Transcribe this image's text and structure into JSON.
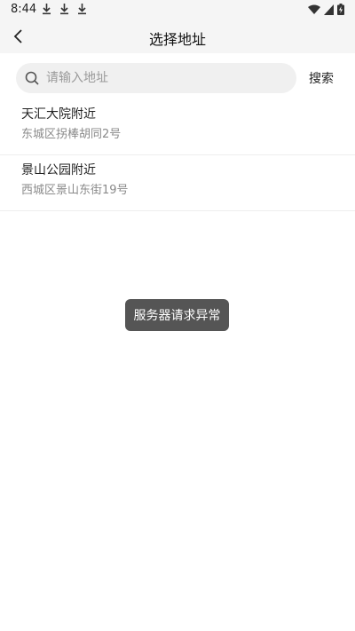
{
  "status_bar": {
    "time": "8:44",
    "icons": [
      "download-icon",
      "download-icon",
      "download-icon",
      "wifi-icon",
      "signal-icon",
      "battery-charging-icon"
    ]
  },
  "header": {
    "title": "选择地址",
    "back_icon": "chevron-left-icon"
  },
  "search": {
    "placeholder": "请输入地址",
    "value": "",
    "button_label": "搜索"
  },
  "results": [
    {
      "name": "天汇大院附近",
      "address": "东城区拐棒胡同2号"
    },
    {
      "name": "景山公园附近",
      "address": "西城区景山东街19号"
    }
  ],
  "toast": {
    "message": "服务器请求异常"
  },
  "colors": {
    "header_bg": "#f5f5f5",
    "search_bg": "#f0f0f0",
    "toast_bg": "#555555",
    "secondary_text": "#8a8a8a"
  }
}
